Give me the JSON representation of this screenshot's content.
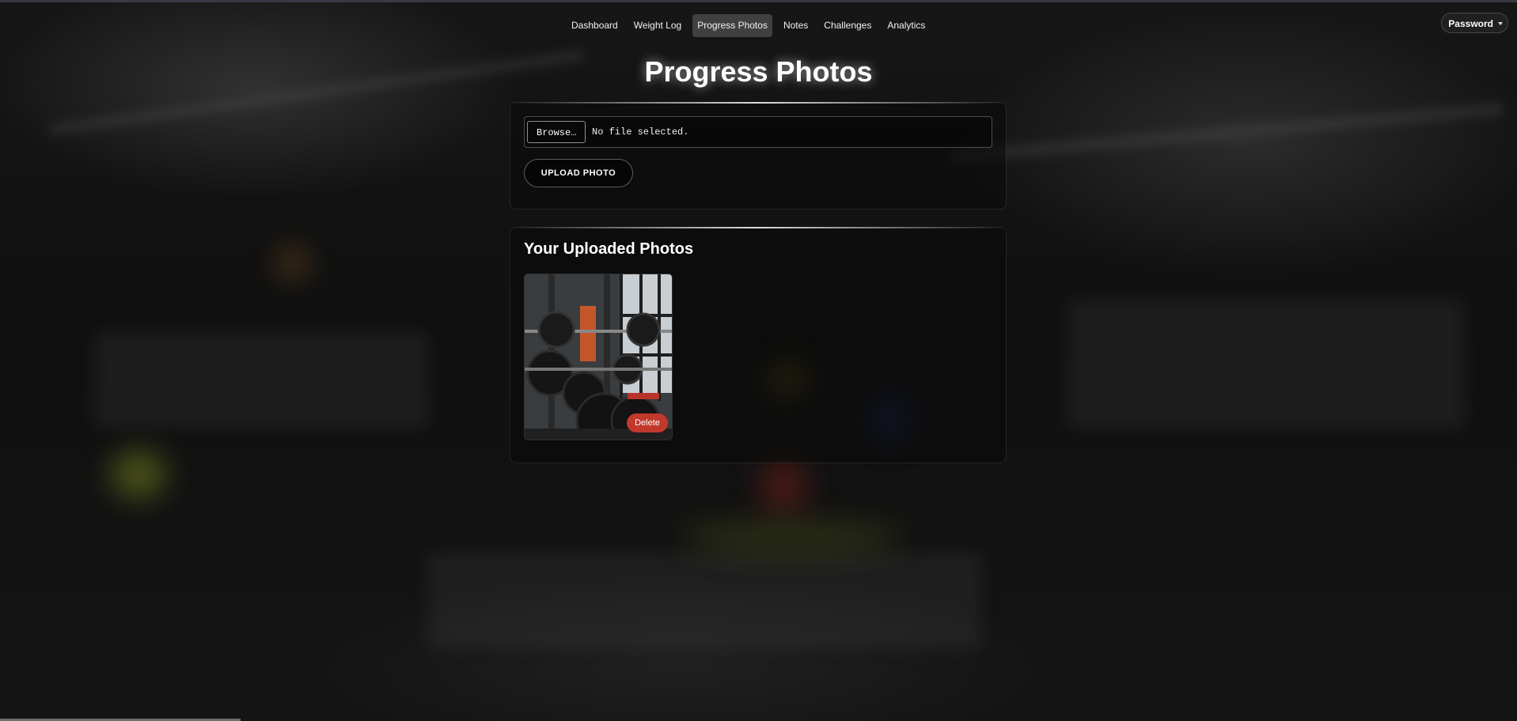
{
  "nav": {
    "items": [
      {
        "label": "Dashboard"
      },
      {
        "label": "Weight Log"
      },
      {
        "label": "Progress Photos"
      },
      {
        "label": "Notes"
      },
      {
        "label": "Challenges"
      },
      {
        "label": "Analytics"
      }
    ],
    "active": "Progress Photos",
    "account_label": "Password"
  },
  "page": {
    "title": "Progress Photos"
  },
  "upload": {
    "browse_label": "Browse…",
    "file_status": "No file selected.",
    "button_label": "UPLOAD PHOTO"
  },
  "photos": {
    "heading": "Your Uploaded Photos",
    "items": [
      {
        "image": "gym barbell rack photo",
        "delete_label": "Delete"
      }
    ]
  },
  "colors": {
    "delete": "#c0392b",
    "active_nav_bg": "rgba(255,255,255,0.18)"
  }
}
